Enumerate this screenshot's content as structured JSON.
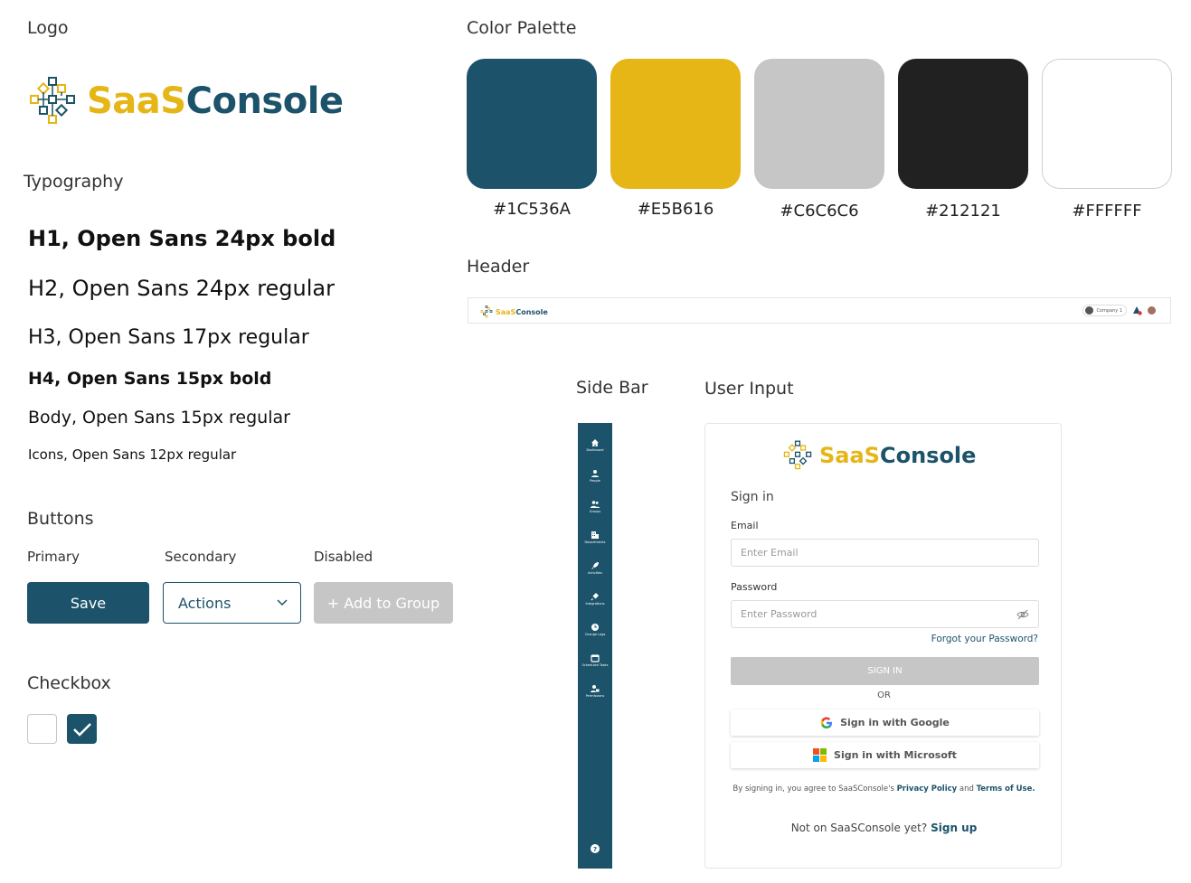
{
  "sections": {
    "logo": "Logo",
    "typography": "Typography",
    "buttons": "Buttons",
    "checkbox": "Checkbox",
    "palette": "Color Palette",
    "header": "Header",
    "sidebar": "Side Bar",
    "user_input": "User Input"
  },
  "brand": {
    "part1": "SaaS",
    "part2": "Console",
    "color_primary": "#1C536A",
    "color_accent": "#E5B616"
  },
  "typography": {
    "h1": "H1, Open Sans 24px bold",
    "h2": "H2, Open Sans 24px regular",
    "h3": "H3, Open Sans 17px regular",
    "h4": "H4, Open Sans 15px bold",
    "body": "Body, Open Sans 15px regular",
    "icons": "Icons, Open Sans 12px regular"
  },
  "buttons": {
    "primary_caption": "Primary",
    "secondary_caption": "Secondary",
    "disabled_caption": "Disabled",
    "save_label": "Save",
    "actions_label": "Actions",
    "add_group_label": "+ Add to Group"
  },
  "checkbox": {
    "states": [
      false,
      true
    ]
  },
  "palette": [
    {
      "hex": "#1C536A",
      "label": "#1C536A"
    },
    {
      "hex": "#E5B616",
      "label": "#E5B616"
    },
    {
      "hex": "#C6C6C6",
      "label": "#C6C6C6"
    },
    {
      "hex": "#212121",
      "label": "#212121"
    },
    {
      "hex": "#FFFFFF",
      "label": "#FFFFFF"
    }
  ],
  "header": {
    "company": "Company 1"
  },
  "sidebar": {
    "items": [
      {
        "label": "Dashboard",
        "icon": "home-icon"
      },
      {
        "label": "People",
        "icon": "person-icon"
      },
      {
        "label": "Groups",
        "icon": "group-icon"
      },
      {
        "label": "Departments",
        "icon": "building-icon"
      },
      {
        "label": "Activities",
        "icon": "rocket-icon"
      },
      {
        "label": "Integrations",
        "icon": "plug-icon"
      },
      {
        "label": "Change Logs",
        "icon": "clock-icon"
      },
      {
        "label": "Scheduled Tasks",
        "icon": "calendar-icon"
      },
      {
        "label": "Permissions",
        "icon": "user-lock-icon"
      }
    ],
    "help_icon": "help-icon"
  },
  "signin": {
    "title": "Sign in",
    "email_label": "Email",
    "email_placeholder": "Enter Email",
    "password_label": "Password",
    "password_placeholder": "Enter Password",
    "forgot": "Forgot your Password?",
    "submit": "SIGN IN",
    "or": "OR",
    "google": "Sign in with Google",
    "microsoft": "Sign in with Microsoft",
    "terms_prefix": "By signing in, you agree to SaaSConsole's",
    "privacy": "Privacy Policy",
    "and": "and",
    "terms_link": "Terms of Use.",
    "signup_prefix": "Not on SaaSConsole yet?",
    "signup_link": "Sign up"
  }
}
